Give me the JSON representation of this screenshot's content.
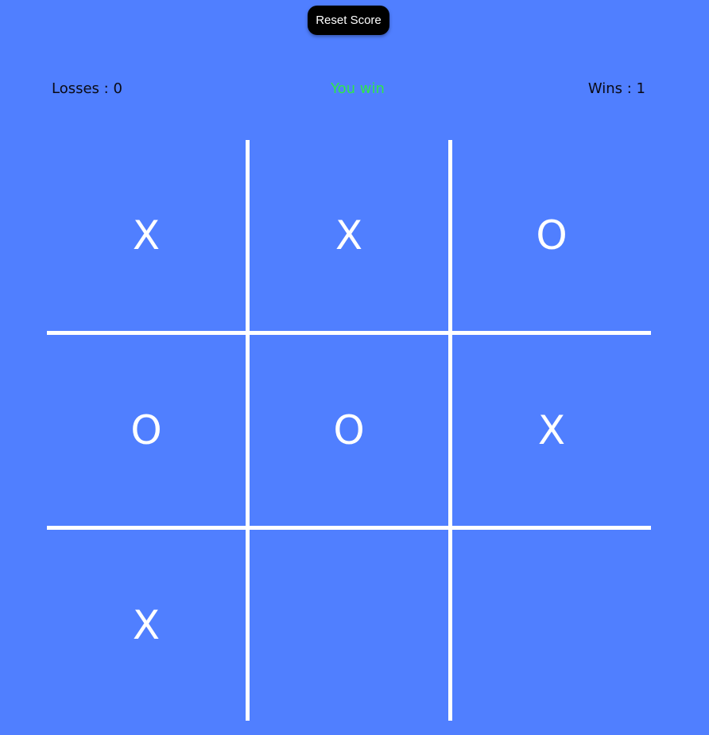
{
  "controls": {
    "reset_label": "Reset Score"
  },
  "scoreboard": {
    "losses_label": "Losses : 0",
    "status_text": "You win",
    "wins_label": "Wins : 1"
  },
  "board": {
    "cells": [
      {
        "mark": "X"
      },
      {
        "mark": "X"
      },
      {
        "mark": "O"
      },
      {
        "mark": "O"
      },
      {
        "mark": "O"
      },
      {
        "mark": "X"
      },
      {
        "mark": "X"
      },
      {
        "mark": ""
      },
      {
        "mark": ""
      }
    ]
  },
  "colors": {
    "background": "#507fff",
    "grid_lines": "#ffffff",
    "mark": "#ffffff",
    "status_win": "#2ee84a",
    "score_text": "#0a0a14",
    "button_bg": "#000000"
  }
}
